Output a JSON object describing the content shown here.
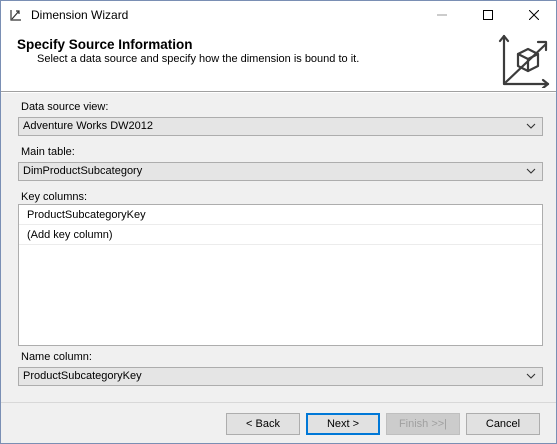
{
  "window": {
    "title": "Dimension Wizard"
  },
  "header": {
    "title": "Specify Source Information",
    "subtitle": "Select a data source and specify how the dimension is bound to it."
  },
  "form": {
    "data_source_view": {
      "label": "Data source view:",
      "value": "Adventure Works DW2012"
    },
    "main_table": {
      "label": "Main table:",
      "value": "DimProductSubcategory"
    },
    "key_columns": {
      "label": "Key columns:",
      "rows": [
        "ProductSubcategoryKey",
        "(Add key column)"
      ]
    },
    "name_column": {
      "label": "Name column:",
      "value": "ProductSubcategoryKey"
    }
  },
  "buttons": {
    "back": "< Back",
    "next": "Next >",
    "finish": "Finish >>|",
    "cancel": "Cancel"
  },
  "colors": {
    "accent": "#0078d7",
    "content_bg": "#f0f0f0",
    "select_bg": "#e5e5e5"
  }
}
